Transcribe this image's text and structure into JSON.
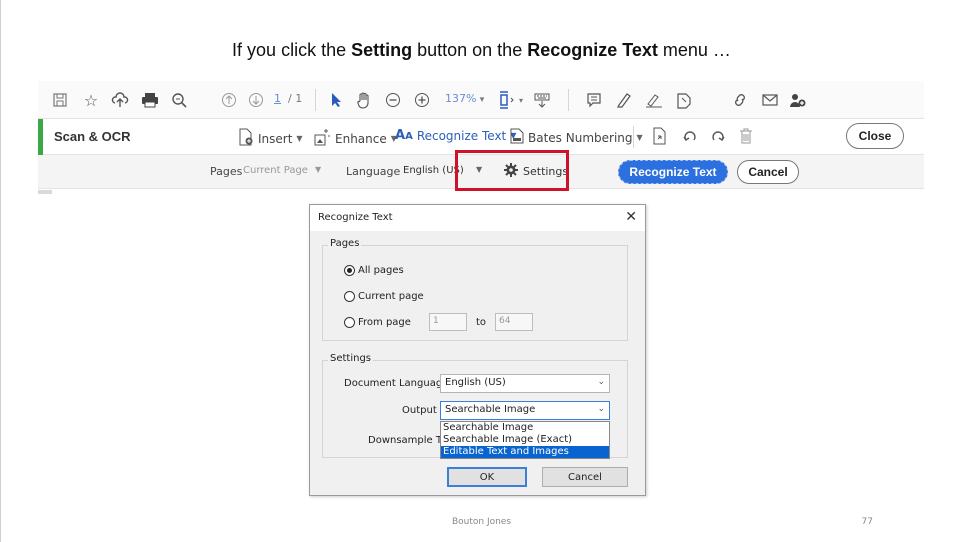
{
  "caption": {
    "prefix": "If you click the ",
    "bold1": "Setting",
    "middle": " button on the ",
    "bold2": "Recognize Text",
    "suffix": " menu …"
  },
  "main_toolbar": {
    "page_current": "1",
    "page_total": "/ 1",
    "zoom": "137%"
  },
  "scan_toolbar": {
    "title": "Scan & OCR",
    "insert": "Insert",
    "enhance": "Enhance",
    "recognize_text": "Recognize Text",
    "bates": "Bates Numbering",
    "close": "Close"
  },
  "options_bar": {
    "pages_label": "Pages",
    "pages_value": "Current Page",
    "language_label": "Language",
    "language_value": "English (US)",
    "settings": "Settings",
    "recognize_btn": "Recognize Text",
    "cancel_btn": "Cancel"
  },
  "dialog": {
    "title": "Recognize Text",
    "pages_group": "Pages",
    "all_pages": "All pages",
    "current_page": "Current page",
    "from_page": "From page",
    "from_value": "1",
    "to_label": "to",
    "to_value": "64",
    "settings_group": "Settings",
    "doc_lang_label": "Document Language",
    "doc_lang_value": "English (US)",
    "output_label": "Output",
    "output_value": "Searchable Image",
    "downsample_label": "Downsample To",
    "output_options": [
      "Searchable Image",
      "Searchable Image (Exact)",
      "Editable Text and Images"
    ],
    "ok": "OK",
    "cancel": "Cancel"
  },
  "footer": {
    "author": "Bouton Jones",
    "slide_number": "77"
  },
  "colors": {
    "accent_green": "#3aa845",
    "highlight_red": "#d0112b",
    "primary_blue": "#2c6fde"
  }
}
